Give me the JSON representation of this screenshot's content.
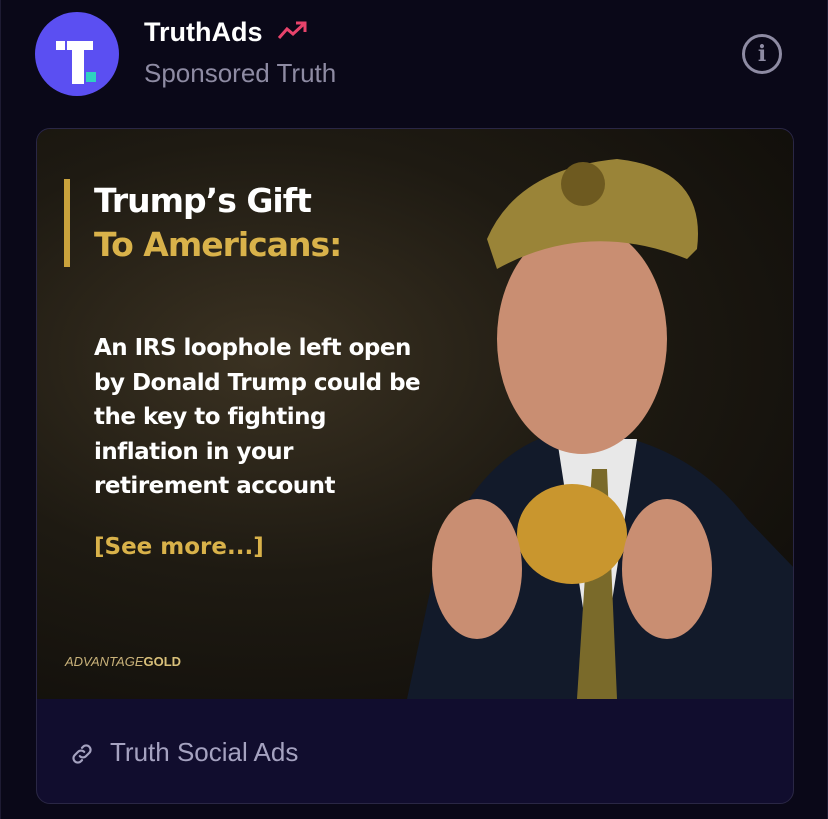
{
  "header": {
    "account_name": "TruthAds",
    "subtitle": "Sponsored Truth",
    "trend_icon": "trending-up-icon",
    "info_icon": "info-icon",
    "accent_color": "#e8436b",
    "avatar_color": "#5b4ff2"
  },
  "ad": {
    "headline_1": "Trump’s Gift",
    "headline_2": "To Americans:",
    "body": "An IRS loophole left open by Donald Trump could be the key to fighting inflation in your retirement account",
    "cta": "[See more...]",
    "brand_prefix": "ADVANTAGE",
    "brand_suffix": "GOLD"
  },
  "footer": {
    "link_icon": "link-icon",
    "label": "Truth Social Ads"
  }
}
